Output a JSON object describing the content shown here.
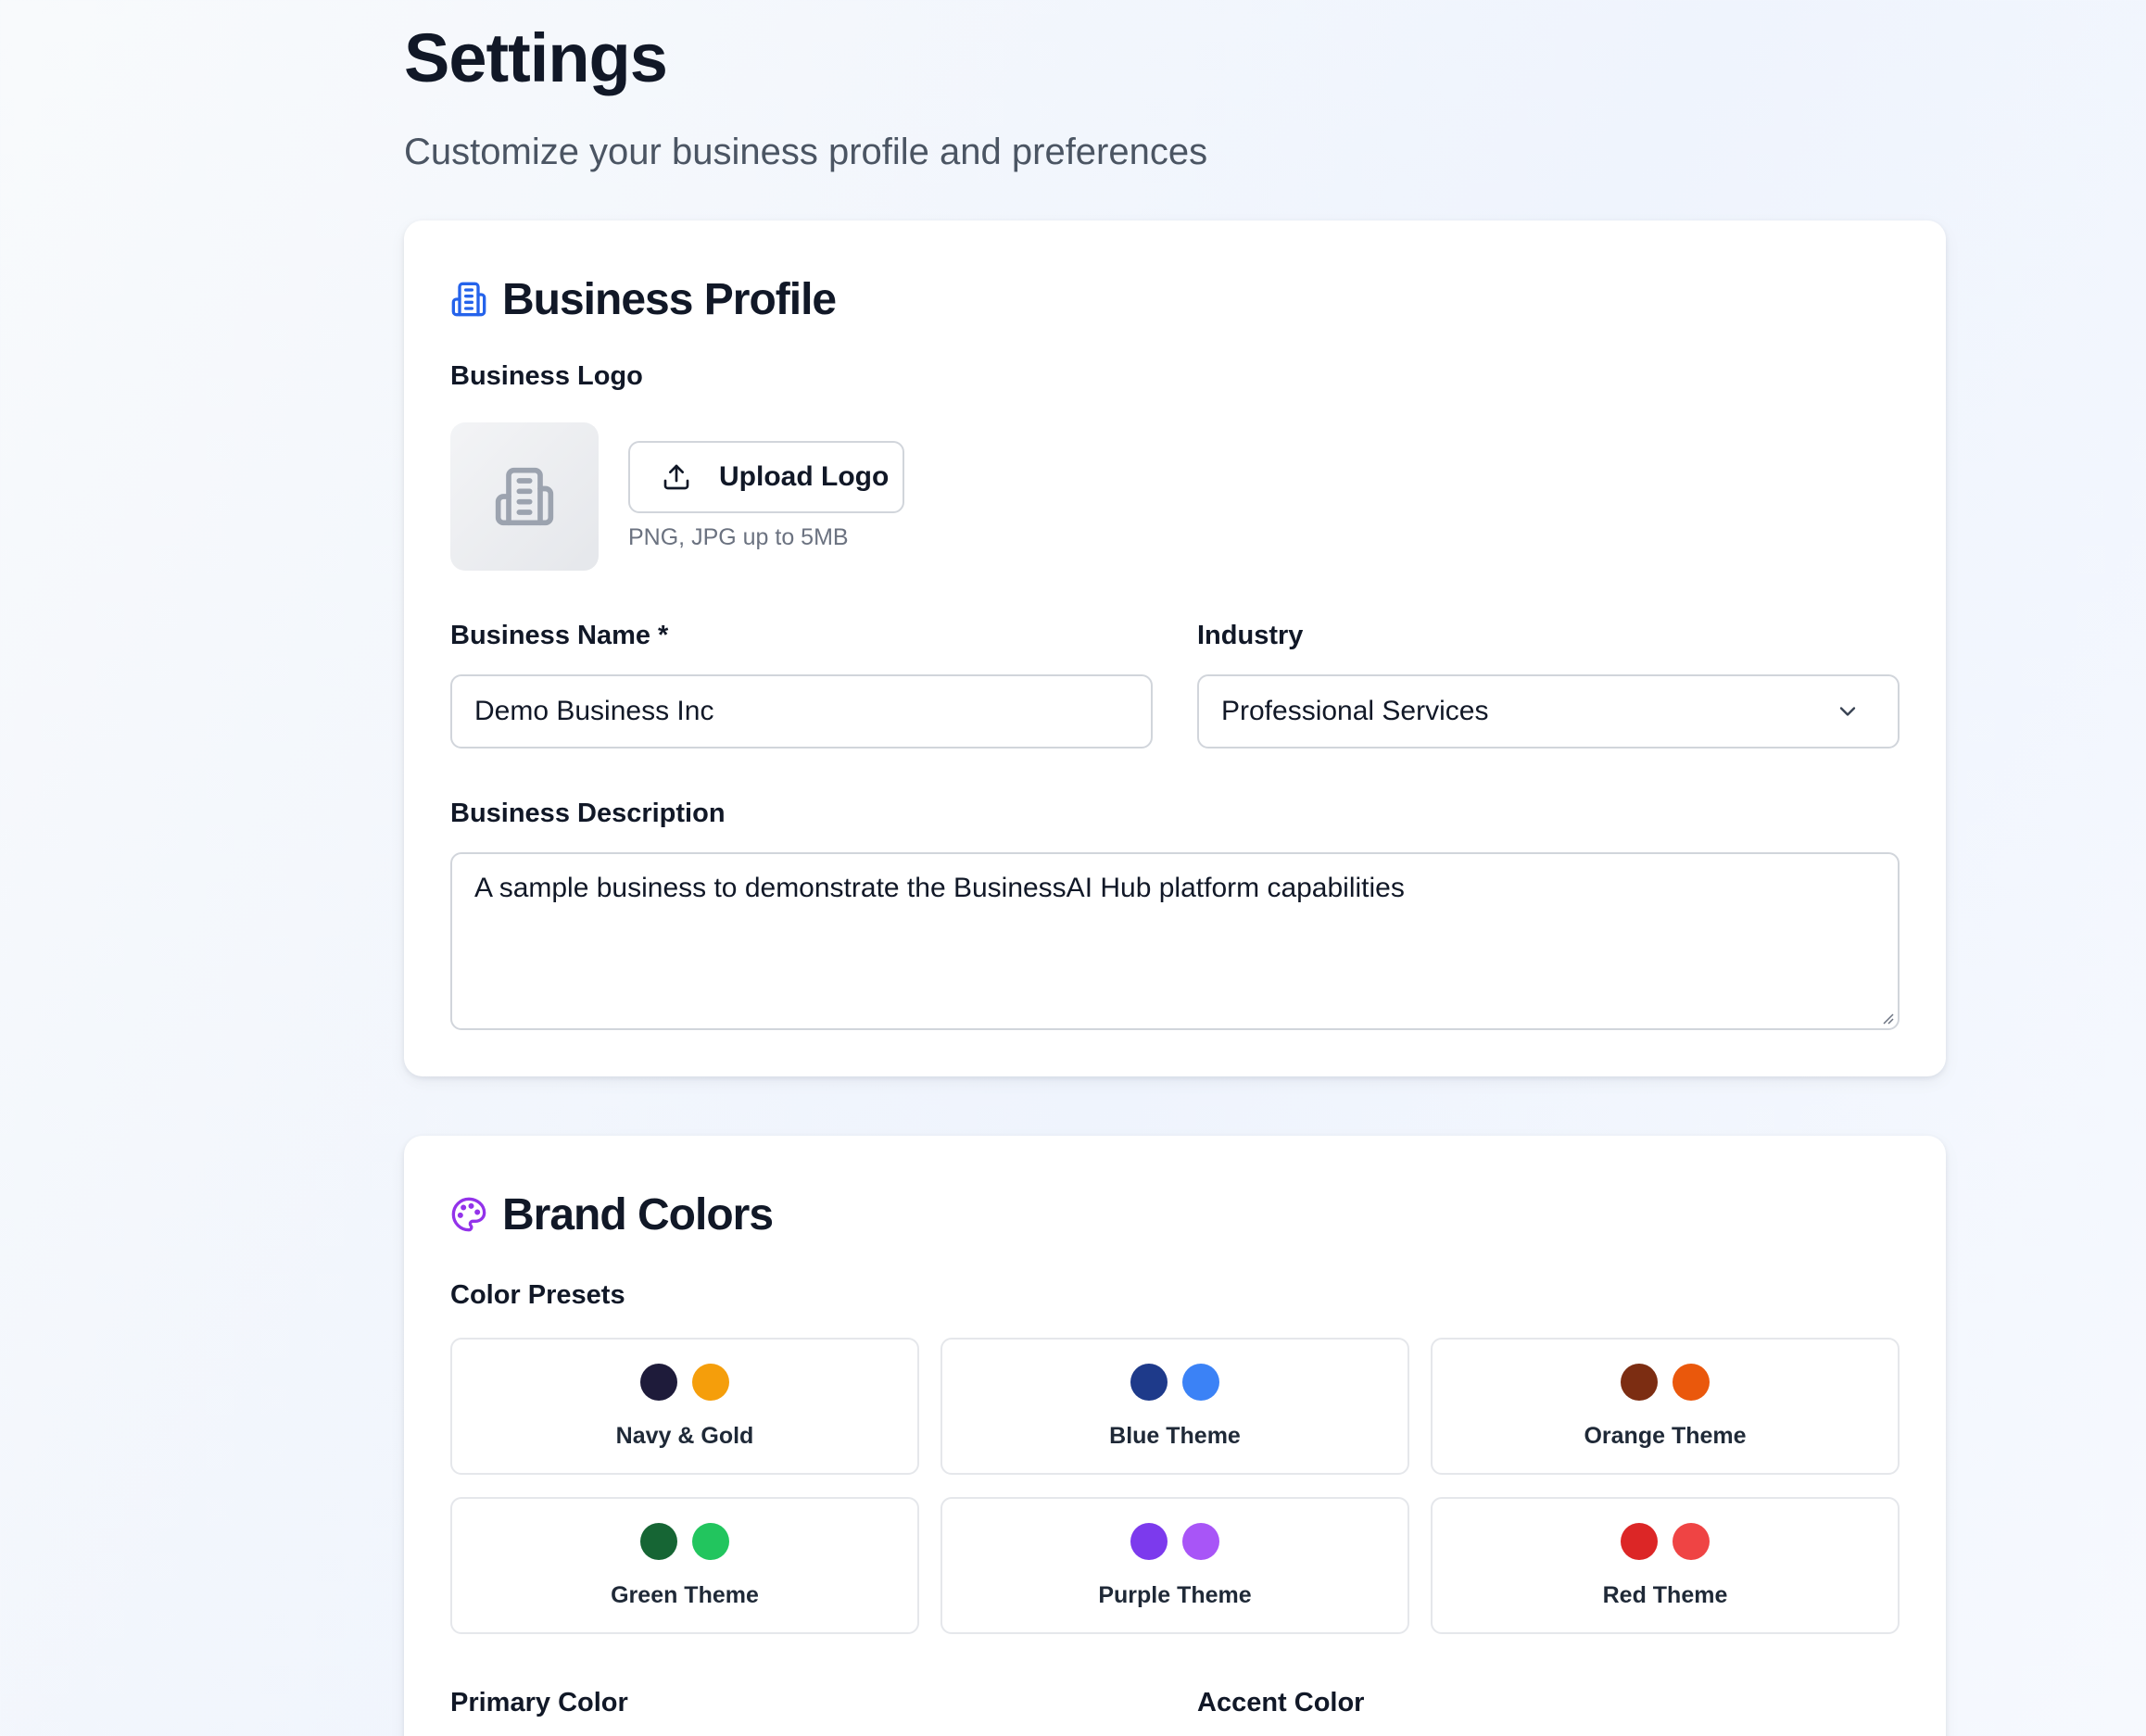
{
  "header": {
    "title": "Settings",
    "subtitle": "Customize your business profile and preferences"
  },
  "business_profile": {
    "heading": "Business Profile",
    "heading_icon": "building-icon",
    "logo_label": "Business Logo",
    "upload_button": "Upload Logo",
    "upload_hint": "PNG, JPG up to 5MB",
    "name_label": "Business Name *",
    "name_value": "Demo Business Inc",
    "industry_label": "Industry",
    "industry_value": "Professional Services",
    "description_label": "Business Description",
    "description_value": "A sample business to demonstrate the BusinessAI Hub platform capabilities"
  },
  "brand_colors": {
    "heading": "Brand Colors",
    "heading_icon": "palette-icon",
    "presets_label": "Color Presets",
    "presets": [
      {
        "label": "Navy & Gold",
        "primary": "#1e1b3a",
        "accent": "#f59e0b"
      },
      {
        "label": "Blue Theme",
        "primary": "#1e3a8a",
        "accent": "#3b82f6"
      },
      {
        "label": "Orange Theme",
        "primary": "#7c2d12",
        "accent": "#ea580c"
      },
      {
        "label": "Green Theme",
        "primary": "#166534",
        "accent": "#22c55e"
      },
      {
        "label": "Purple Theme",
        "primary": "#7c3aed",
        "accent": "#a855f7"
      },
      {
        "label": "Red Theme",
        "primary": "#dc2626",
        "accent": "#ef4444"
      }
    ],
    "primary_label": "Primary Color",
    "accent_label": "Accent Color"
  },
  "colors": {
    "profile_icon": "#2563eb",
    "palette_icon": "#9333ea"
  }
}
